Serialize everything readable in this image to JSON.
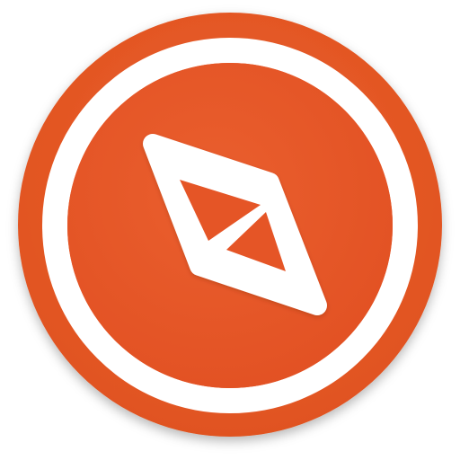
{
  "icon": {
    "name": "compass-app-icon",
    "shape": "circle",
    "colors": {
      "outer_disc": "#E35623",
      "inner_disc": "#E55528",
      "ring": "#FFFFFF",
      "needle": "#FFFFFF",
      "background": "#FFFFFF"
    }
  }
}
